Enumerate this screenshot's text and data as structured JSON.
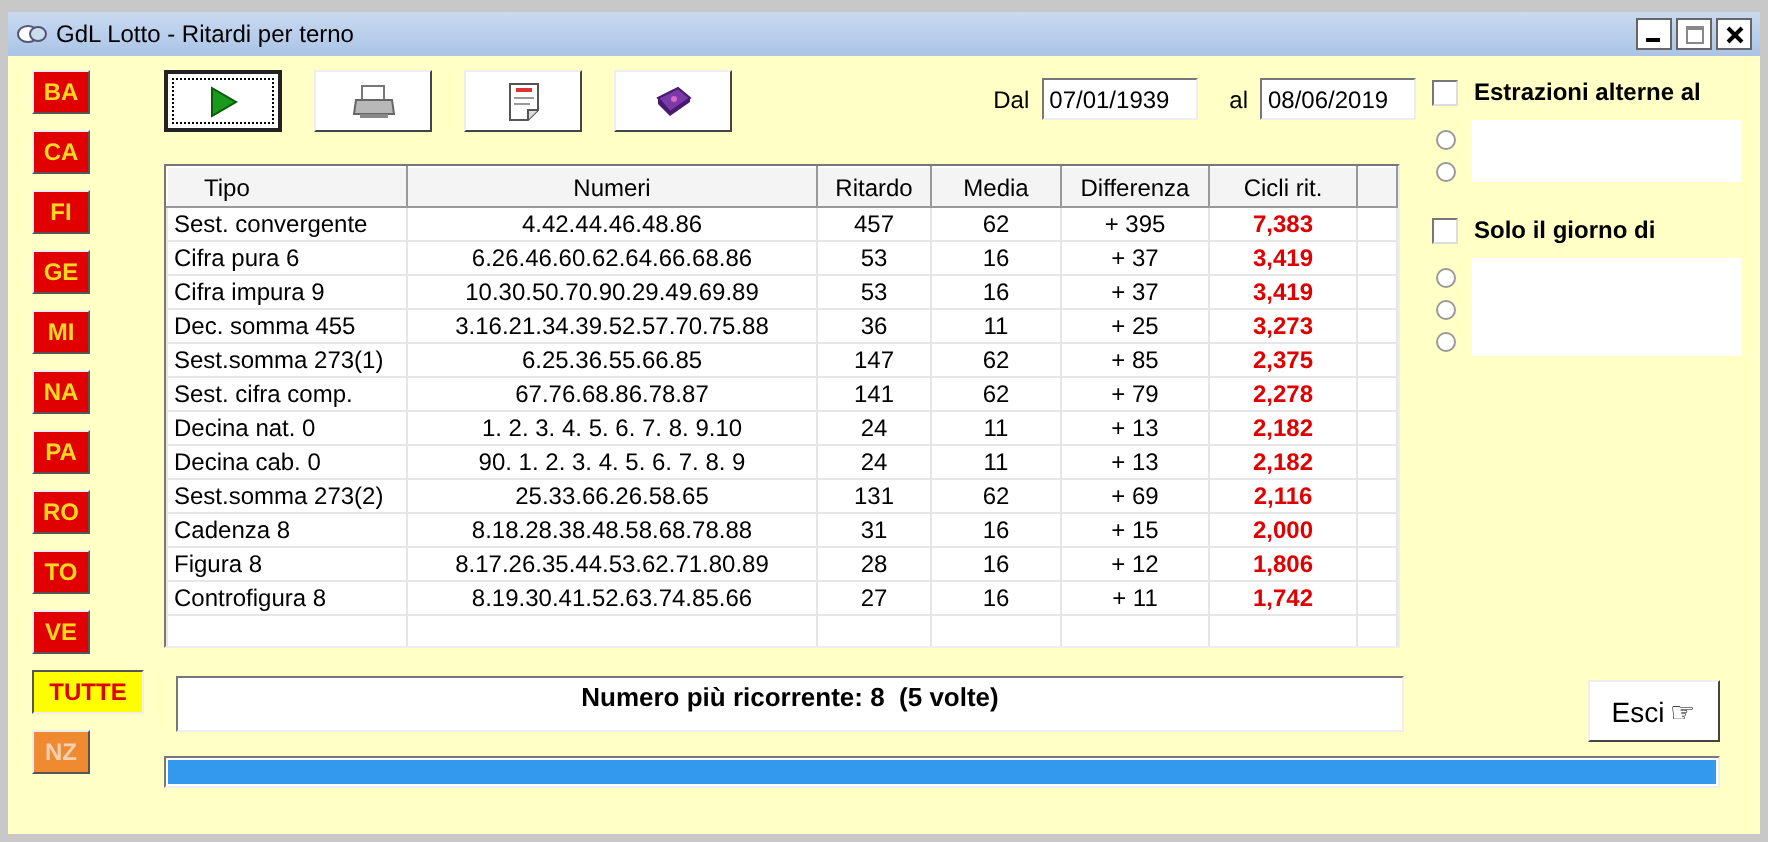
{
  "window": {
    "title": "GdL Lotto - Ritardi per terno"
  },
  "cities": [
    {
      "label": "BA",
      "selected": false,
      "disabled": false
    },
    {
      "label": "CA",
      "selected": false,
      "disabled": false
    },
    {
      "label": "FI",
      "selected": false,
      "disabled": false
    },
    {
      "label": "GE",
      "selected": false,
      "disabled": false
    },
    {
      "label": "MI",
      "selected": false,
      "disabled": false
    },
    {
      "label": "NA",
      "selected": false,
      "disabled": false
    },
    {
      "label": "PA",
      "selected": false,
      "disabled": false
    },
    {
      "label": "RO",
      "selected": false,
      "disabled": false
    },
    {
      "label": "TO",
      "selected": false,
      "disabled": false
    },
    {
      "label": "VE",
      "selected": false,
      "disabled": false
    },
    {
      "label": "TUTTE",
      "selected": true,
      "disabled": false
    },
    {
      "label": "NZ",
      "selected": false,
      "disabled": true
    }
  ],
  "toolbar": [
    {
      "kind": "run",
      "focused": true
    },
    {
      "kind": "print",
      "focused": false
    },
    {
      "kind": "note",
      "focused": false
    },
    {
      "kind": "help",
      "focused": false
    }
  ],
  "date_range": {
    "from_label": "Dal",
    "from_value": "07/01/1939",
    "to_label": "al",
    "to_value": "08/06/2019"
  },
  "table": {
    "columns": [
      "Tipo",
      "Numeri",
      "Ritardo",
      "Media",
      "Differenza",
      "Cicli rit."
    ],
    "rows": [
      [
        "Sest. convergente",
        "4.42.44.46.48.86",
        "457",
        "62",
        "+ 395",
        "7,383"
      ],
      [
        "Cifra pura 6",
        "6.26.46.60.62.64.66.68.86",
        "53",
        "16",
        "+ 37",
        "3,419"
      ],
      [
        "Cifra impura 9",
        "10.30.50.70.90.29.49.69.89",
        "53",
        "16",
        "+ 37",
        "3,419"
      ],
      [
        "Dec. somma 455",
        "3.16.21.34.39.52.57.70.75.88",
        "36",
        "11",
        "+ 25",
        "3,273"
      ],
      [
        "Sest.somma 273(1)",
        "6.25.36.55.66.85",
        "147",
        "62",
        "+ 85",
        "2,375"
      ],
      [
        "Sest. cifra comp.",
        "67.76.68.86.78.87",
        "141",
        "62",
        "+ 79",
        "2,278"
      ],
      [
        "Decina nat. 0",
        "1. 2. 3. 4. 5. 6. 7. 8. 9.10",
        "24",
        "11",
        "+ 13",
        "2,182"
      ],
      [
        "Decina cab. 0",
        "90. 1. 2. 3. 4. 5. 6. 7. 8. 9",
        "24",
        "11",
        "+ 13",
        "2,182"
      ],
      [
        "Sest.somma 273(2)",
        "25.33.66.26.58.65",
        "131",
        "62",
        "+ 69",
        "2,116"
      ],
      [
        "Cadenza 8",
        "8.18.28.38.48.58.68.78.88",
        "31",
        "16",
        "+ 15",
        "2,000"
      ],
      [
        "Figura 8",
        "8.17.26.35.44.53.62.71.80.89",
        "28",
        "16",
        "+ 12",
        "1,806"
      ],
      [
        "Controfigura 8",
        "8.19.30.41.52.63.74.85.66",
        "27",
        "16",
        "+ 11",
        "1,742"
      ]
    ]
  },
  "options": [
    {
      "label": "Estrazioni alterne al",
      "checked": false,
      "radios": [
        {
          "selected": false
        },
        {
          "selected": false
        }
      ]
    },
    {
      "label": "Solo il giorno di",
      "checked": false,
      "radios": [
        {
          "selected": false
        },
        {
          "selected": false
        },
        {
          "selected": false
        }
      ]
    }
  ],
  "message": "Numero più ricorrente: 8  (5 volte)",
  "exit_button": {
    "label": "Esci",
    "icon": "☞"
  },
  "progress": {
    "level": 1
  }
}
